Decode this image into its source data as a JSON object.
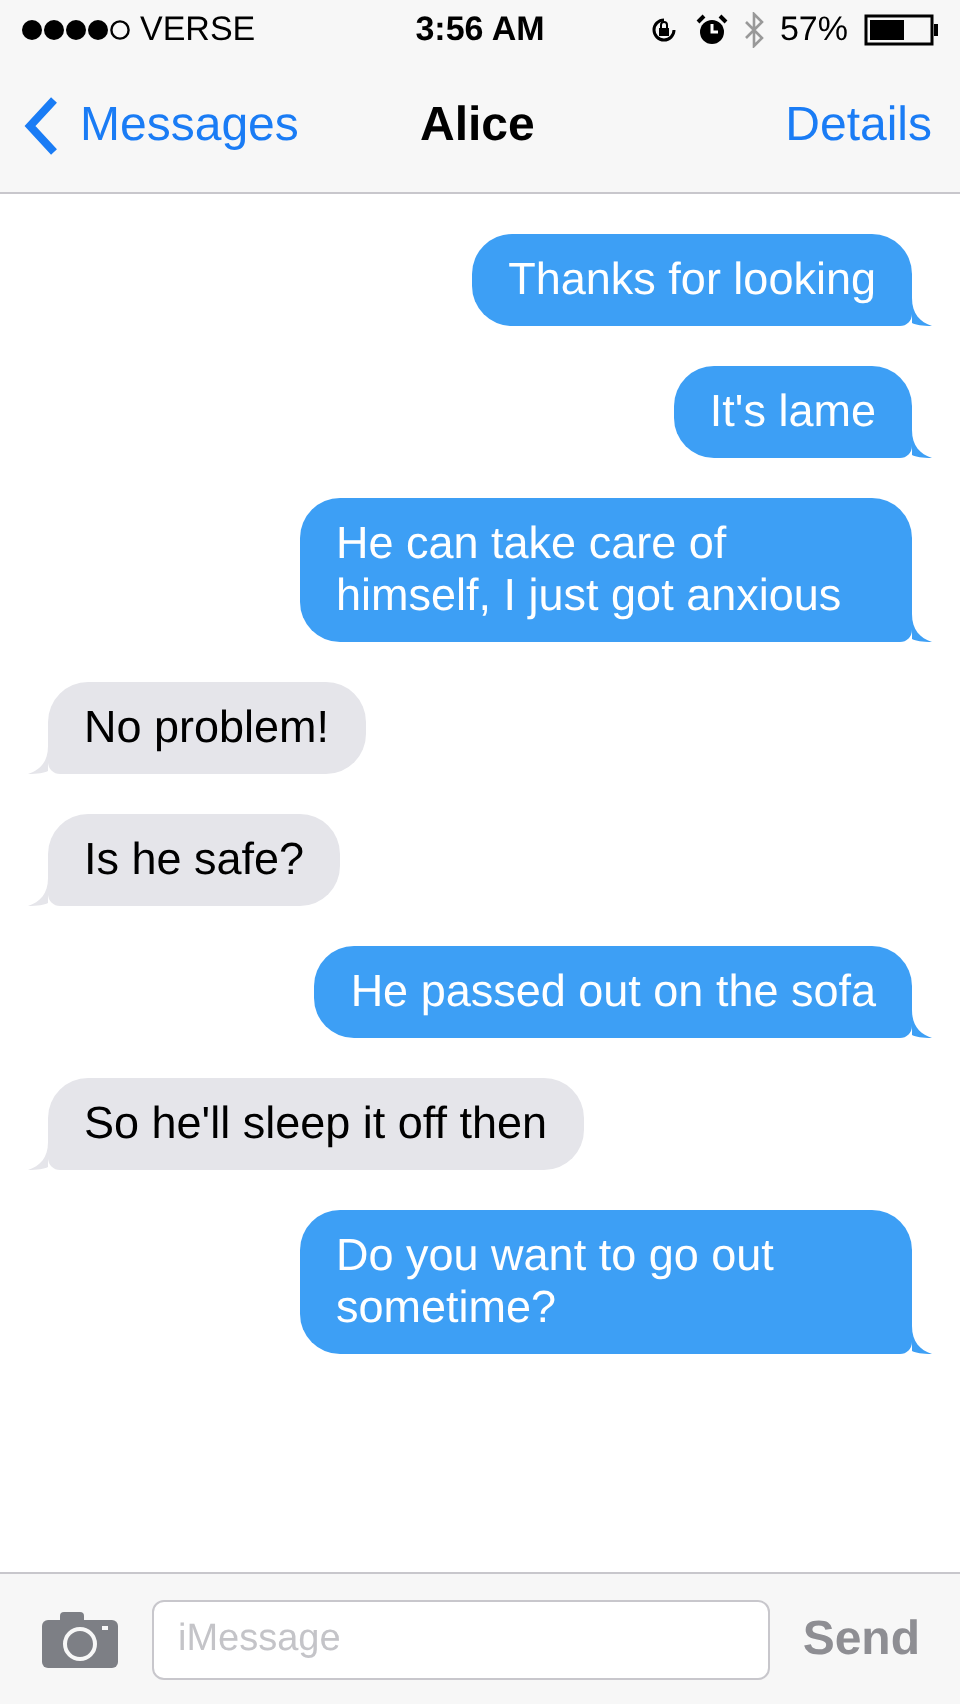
{
  "status_bar": {
    "carrier": "VERSE",
    "time": "3:56 AM",
    "battery": "57%"
  },
  "nav": {
    "back": "Messages",
    "title": "Alice",
    "action": "Details"
  },
  "messages": [
    {
      "kind": "sent",
      "text": "Thanks for looking"
    },
    {
      "kind": "sent",
      "text": "It's lame"
    },
    {
      "kind": "sent",
      "text": "He can take care of himself, I just got anxious"
    },
    {
      "kind": "received",
      "text": "No problem!"
    },
    {
      "kind": "received",
      "text": "Is he safe?"
    },
    {
      "kind": "sent",
      "text": "He passed out on the sofa"
    },
    {
      "kind": "received",
      "text": "So he'll sleep it off then"
    },
    {
      "kind": "sent",
      "text": "Do you want to go out sometime?"
    }
  ],
  "composer": {
    "placeholder": "iMessage",
    "send": "Send"
  }
}
